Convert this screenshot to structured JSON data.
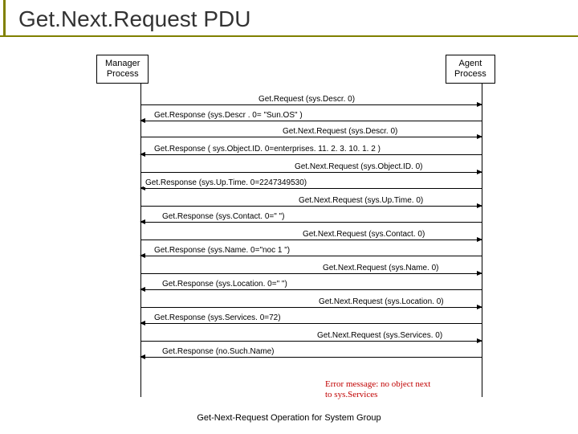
{
  "title": "Get.Next.Request PDU",
  "manager_process": "Manager\nProcess",
  "agent_process": "Agent\nProcess",
  "messages": {
    "m1": "Get.Request (sys.Descr. 0)",
    "m2": "Get.Response (sys.Descr . 0= \"Sun.OS\" )",
    "m3": "Get.Next.Request (sys.Descr. 0)",
    "m4": "Get.Response ( sys.Object.ID. 0=enterprises. 11. 2. 3. 10. 1. 2 )",
    "m5": "Get.Next.Request (sys.Object.ID. 0)",
    "m6": "Get.Response (sys.Up.Time. 0=2247349530)",
    "m7": "Get.Next.Request (sys.Up.Time. 0)",
    "m8": "Get.Response (sys.Contact. 0=\" \")",
    "m9": "Get.Next.Request (sys.Contact. 0)",
    "m10": "Get.Response (sys.Name. 0=\"noc 1 \")",
    "m11": "Get.Next.Request (sys.Name. 0)",
    "m12": "Get.Response (sys.Location. 0=\" \")",
    "m13": "Get.Next.Request (sys.Location. 0)",
    "m14": "Get.Response (sys.Services. 0=72)",
    "m15": "Get.Next.Request (sys.Services. 0)",
    "m16": "Get.Response (no.Such.Name)"
  },
  "error_text": "Error message: no object next\nto sys.Services",
  "caption": "Get-Next-Request Operation for System Group"
}
